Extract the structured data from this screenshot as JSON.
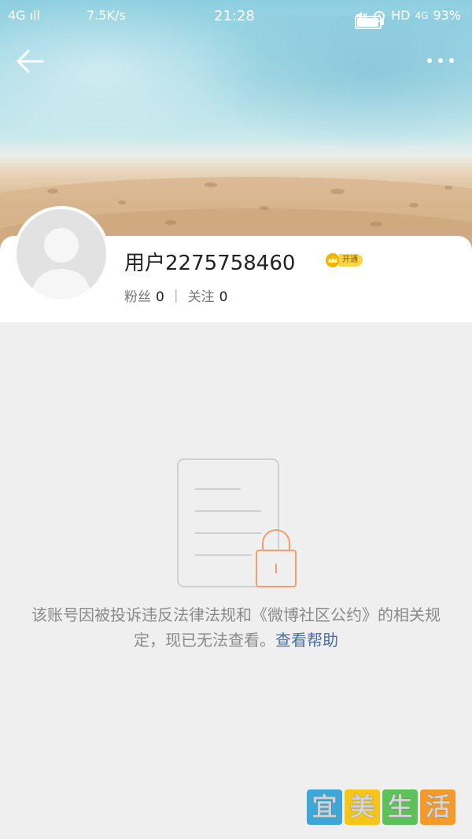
{
  "status_bar": {
    "signal": "4G   ıl",
    "speed": "7.5K/s",
    "time": "21:28",
    "hd": "HD",
    "battery": "93%"
  },
  "profile": {
    "username": "用户2275758460",
    "vip_label": "开通",
    "fans_label": "粉丝",
    "fans_count": "0",
    "following_label": "关注",
    "following_count": "0"
  },
  "notice": {
    "message": "该账号因被投诉违反法律法规和《微博社区公约》的相关规定，现已无法查看。",
    "help_link": "查看帮助"
  },
  "watermark": {
    "chars": [
      "宜",
      "美",
      "生",
      "活"
    ],
    "colors": [
      "#3fa7d6",
      "#f5c518",
      "#5cc15a",
      "#f39a2b"
    ]
  },
  "icons": {
    "back": "arrow-left-icon",
    "more": "more-dots-icon",
    "illustration": "locked-document-icon"
  }
}
